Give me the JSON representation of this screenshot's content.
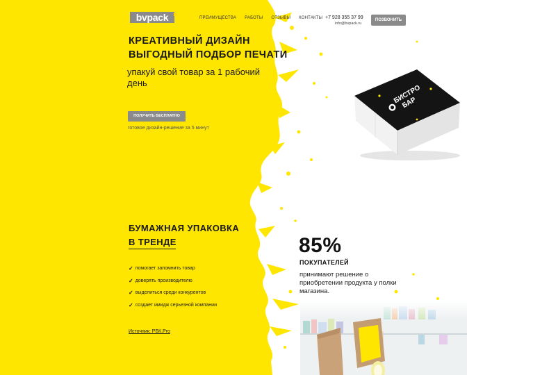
{
  "header": {
    "logo_text": "bvpack",
    "nav": [
      "ПРЕИМУЩЕСТВА",
      "РАБОТЫ",
      "ОТЗЫВЫ",
      "КОНТАКТЫ"
    ],
    "phone": "+7 928 355 37 99",
    "email": "info@bvpack.ru",
    "call_button": "ПОЗВОНИТЬ"
  },
  "hero": {
    "title_line1": "КРЕАТИВНЫЙ ДИЗАЙН",
    "title_line2": "ВЫГОДНЫЙ ПОДБОР ПЕЧАТИ",
    "subtitle": "упакуй свой товар за 1 рабочий день",
    "cta_button": "ПОЛУЧИТЬ БЕСПЛАТНО",
    "cta_note": "готовое дизайн-решение за 5 минут"
  },
  "product": {
    "box_text_line1": "БИСТРО",
    "box_text_line2": "БАР"
  },
  "trend": {
    "title_line1": "БУМАЖНАЯ УПАКОВКА",
    "title_line2": "В ТРЕНДЕ",
    "benefits": [
      "помогает запомнить товар",
      "доверять производителю",
      "выделиться среди конкурентов",
      "создает имидж серьезной компании"
    ],
    "source": "Источник: РБК.Pro",
    "stat_value": "85%",
    "stat_label": "ПОКУПАТЕЛЕЙ",
    "stat_desc": "принимают решение о приобретении продукта у полки магазина."
  },
  "colors": {
    "accent_yellow": "#ffe600",
    "button_gray": "#8a8a8a",
    "text_dark": "#1a1a1a",
    "box_black": "#141414"
  },
  "icons": {
    "check": "✓"
  }
}
